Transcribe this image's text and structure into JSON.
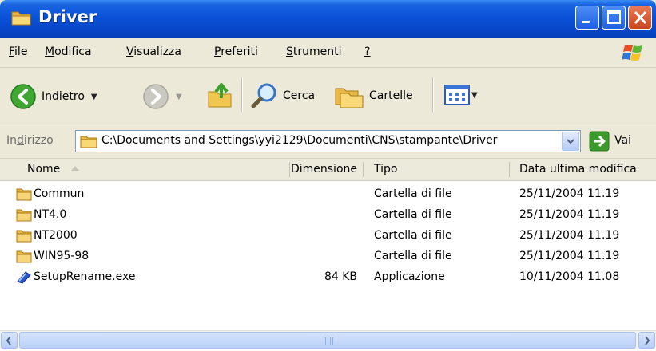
{
  "window": {
    "title": "Driver"
  },
  "menu": [
    {
      "label": "File",
      "underline": "F",
      "rest": "ile"
    },
    {
      "label": "Modifica",
      "underline": "M",
      "rest": "odifica"
    },
    {
      "label": "Visualizza",
      "underline": "V",
      "rest": "isualizza"
    },
    {
      "label": "Preferiti",
      "underline": "P",
      "rest": "referiti"
    },
    {
      "label": "Strumenti",
      "underline": "S",
      "rest": "trumenti"
    },
    {
      "label": "?",
      "underline": "?",
      "rest": ""
    }
  ],
  "toolbar": {
    "back_label": "Indietro",
    "search_label": "Cerca",
    "folders_label": "Cartelle"
  },
  "address": {
    "label_pre": "In",
    "label_ul": "d",
    "label_post": "irizzo",
    "path": "C:\\Documents and Settings\\yyi2129\\Documenti\\CNS\\stampante\\Driver",
    "go_label": "Vai"
  },
  "columns": {
    "name": "Nome",
    "size": "Dimensione",
    "type": "Tipo",
    "modified": "Data ultima modifica"
  },
  "files": [
    {
      "name": "Commun",
      "size": "",
      "type": "Cartella di file",
      "modified": "25/11/2004 11.19",
      "icon": "folder"
    },
    {
      "name": "NT4.0",
      "size": "",
      "type": "Cartella di file",
      "modified": "25/11/2004 11.19",
      "icon": "folder"
    },
    {
      "name": "NT2000",
      "size": "",
      "type": "Cartella di file",
      "modified": "25/11/2004 11.19",
      "icon": "folder"
    },
    {
      "name": "WIN95-98",
      "size": "",
      "type": "Cartella di file",
      "modified": "25/11/2004 11.19",
      "icon": "folder"
    },
    {
      "name": "SetupRename.exe",
      "size": "84 KB",
      "type": "Applicazione",
      "modified": "10/11/2004 11.08",
      "icon": "application"
    }
  ],
  "colors": {
    "titlebar": "#0a52d8",
    "close_button": "#c9451d",
    "chrome": "#ece9d8",
    "go_arrow": "#3c9a2c",
    "folder": "#f5d16a"
  }
}
